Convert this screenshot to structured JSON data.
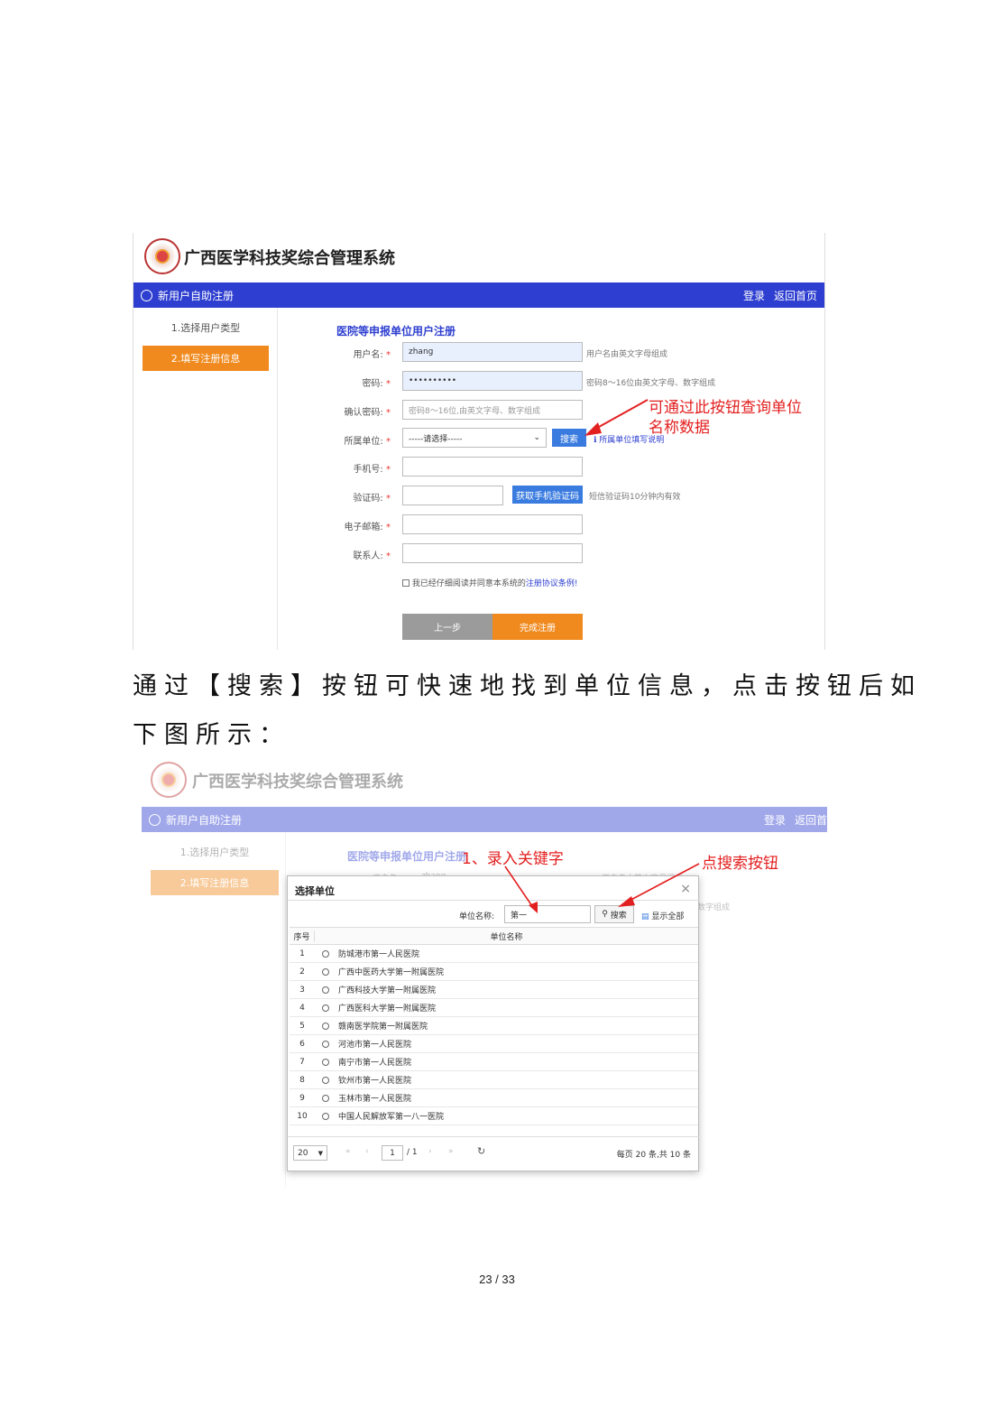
{
  "shot1": {
    "system_title": "广西医学科技奖综合管理系统",
    "nav": {
      "title": "新用户自助注册",
      "login": "登录",
      "home": "返回首页"
    },
    "steps": [
      "1.选择用户类型",
      "2.填写注册信息"
    ],
    "form_title": "医院等申报单位用户注册",
    "fields": {
      "username": {
        "label": "用户名:",
        "value": "zhang",
        "hint": "用户名由英文字母组成"
      },
      "password": {
        "label": "密码:",
        "value": "••••••••••",
        "hint": "密码8～16位由英文字母、数字组成"
      },
      "confirm": {
        "label": "确认密码:",
        "placeholder": "密码8～16位,由英文字母、数字组成"
      },
      "unit": {
        "label": "所属单位:",
        "value": "-----请选择-----",
        "search": "搜索",
        "help": "所属单位填写说明"
      },
      "phone": {
        "label": "手机号:"
      },
      "code": {
        "label": "验证码:",
        "button": "获取手机验证码",
        "hint": "短信验证码10分钟内有效"
      },
      "email": {
        "label": "电子邮箱:"
      },
      "contact": {
        "label": "联系人:"
      }
    },
    "required_mark": "*",
    "agree_text": "我已经仔细阅读并同意本系统的",
    "agree_link": "注册协议条例!",
    "prev": "上一步",
    "finish": "完成注册",
    "annotation": "可通过此按钮查询单位名称数据"
  },
  "paragraph": {
    "line1": "通过【搜索】按钮可快速地找到单位信息，点击按钮后如",
    "line2": "下图所示："
  },
  "shot2": {
    "system_title": "广西医学科技奖综合管理系统",
    "nav": {
      "title": "新用户自助注册",
      "login": "登录",
      "home": "返回首"
    },
    "steps": [
      "1.选择用户类型",
      "2.填写注册信息"
    ],
    "form_title": "医院等申报单位用户注册",
    "bg_username_label": "用户名:",
    "bg_username_value": "zhang",
    "bg_username_hint": "用户名由英文字母组成",
    "bg_hint2": "数字组成",
    "annotation1": "1、录入关键字",
    "annotation2": "点搜索按钮",
    "modal": {
      "title": "选择单位",
      "close": "×",
      "search_label": "单位名称:",
      "search_value": "第一",
      "search_button": "搜索",
      "show_all": "显示全部",
      "col_no": "序号",
      "col_name": "单位名称",
      "rows": [
        {
          "no": "1",
          "name": "防城港市第一人民医院"
        },
        {
          "no": "2",
          "name": "广西中医药大学第一附属医院"
        },
        {
          "no": "3",
          "name": "广西科技大学第一附属医院"
        },
        {
          "no": "4",
          "name": "广西医科大学第一附属医院"
        },
        {
          "no": "5",
          "name": "赣南医学院第一附属医院"
        },
        {
          "no": "6",
          "name": "河池市第一人民医院"
        },
        {
          "no": "7",
          "name": "南宁市第一人民医院"
        },
        {
          "no": "8",
          "name": "钦州市第一人民医院"
        },
        {
          "no": "9",
          "name": "玉林市第一人民医院"
        },
        {
          "no": "10",
          "name": "中国人民解放军第一八一医院"
        }
      ],
      "page_size": "20",
      "page_current": "1",
      "page_total": "/ 1",
      "summary": "每页 20 条,共 10 条"
    }
  },
  "page_number": "23 / 33",
  "colors": {
    "nav": "#2d3ed0",
    "accent": "#f08a1e",
    "annotation": "#e32020"
  }
}
